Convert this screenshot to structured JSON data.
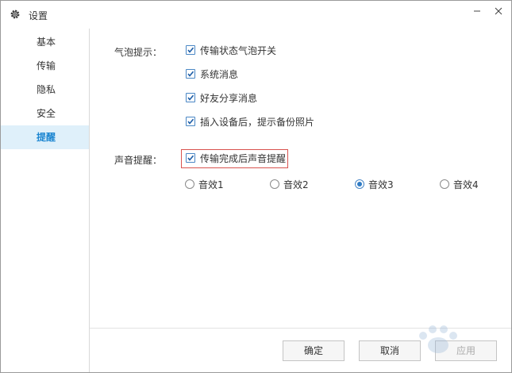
{
  "window": {
    "title": "设置"
  },
  "sidebar": {
    "items": [
      {
        "label": "基本",
        "active": false
      },
      {
        "label": "传输",
        "active": false
      },
      {
        "label": "隐私",
        "active": false
      },
      {
        "label": "安全",
        "active": false
      },
      {
        "label": "提醒",
        "active": true
      }
    ]
  },
  "bubble": {
    "label": "气泡提示：",
    "options": [
      {
        "label": "传输状态气泡开关",
        "checked": true
      },
      {
        "label": "系统消息",
        "checked": true
      },
      {
        "label": "好友分享消息",
        "checked": true
      },
      {
        "label": "插入设备后，提示备份照片",
        "checked": true
      }
    ]
  },
  "sound": {
    "label": "声音提醒：",
    "option": {
      "label": "传输完成后声音提醒",
      "checked": true
    },
    "effects": [
      {
        "label": "音效1",
        "selected": false
      },
      {
        "label": "音效2",
        "selected": false
      },
      {
        "label": "音效3",
        "selected": true
      },
      {
        "label": "音效4",
        "selected": false
      }
    ]
  },
  "footer": {
    "ok_label": "确定",
    "cancel_label": "取消",
    "apply_label": "应用"
  },
  "colors": {
    "accent": "#1c86d1",
    "active_bg": "#dff0fa",
    "highlight": "#d9534f"
  },
  "icons": {
    "title": "gear-icon",
    "minimize": "minimize-icon",
    "close": "close-icon"
  }
}
